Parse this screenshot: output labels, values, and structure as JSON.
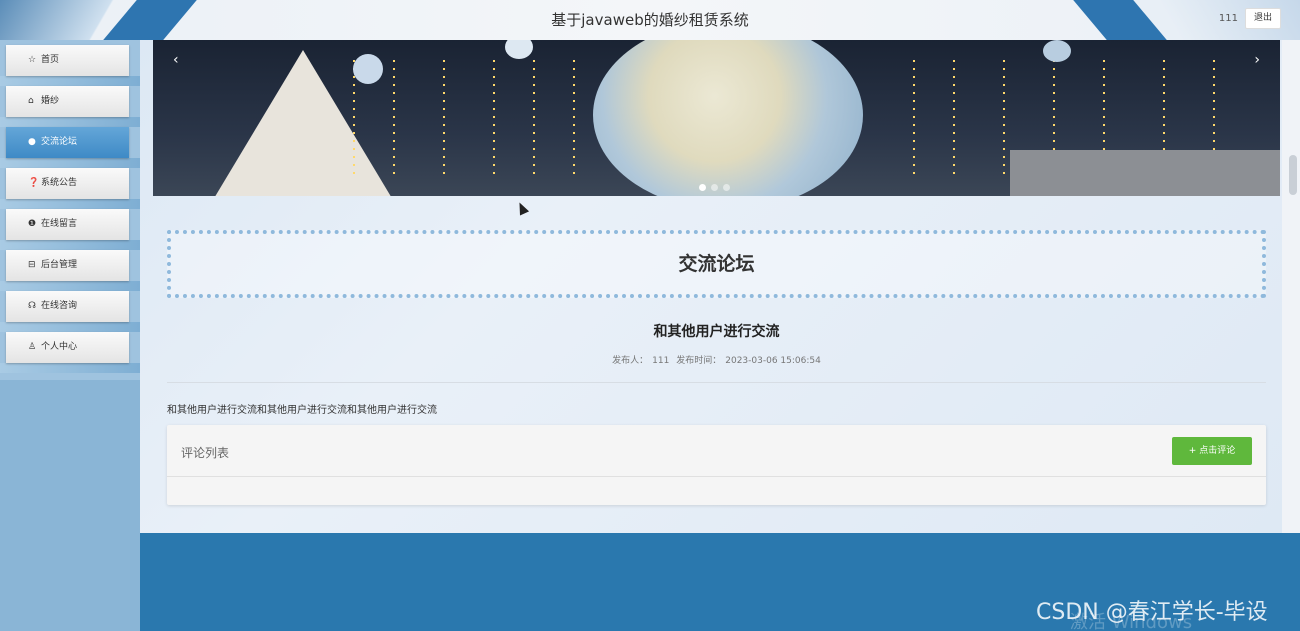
{
  "header": {
    "title": "基于javaweb的婚纱租赁系统",
    "user": "111",
    "logout_label": "退出"
  },
  "sidebar": {
    "items": [
      {
        "label": "首页",
        "icon": "star-icon",
        "glyph": "☆"
      },
      {
        "label": "婚纱",
        "icon": "lock-icon",
        "glyph": "⌂"
      },
      {
        "label": "交流论坛",
        "icon": "chat-icon",
        "glyph": "●"
      },
      {
        "label": "系统公告",
        "icon": "question-icon",
        "glyph": "❓"
      },
      {
        "label": "在线留言",
        "icon": "info-icon",
        "glyph": "❶"
      },
      {
        "label": "后台管理",
        "icon": "briefcase-icon",
        "glyph": "⊟"
      },
      {
        "label": "在线咨询",
        "icon": "headset-icon",
        "glyph": "☊"
      },
      {
        "label": "个人中心",
        "icon": "user-icon",
        "glyph": "♙"
      }
    ],
    "active_index": 2
  },
  "banner": {
    "prev": "‹",
    "next": "›",
    "slides": 3,
    "active_slide": 0
  },
  "forum": {
    "section_title": "交流论坛",
    "post_title": "和其他用户进行交流",
    "author_label": "发布人：",
    "author": "111",
    "time_label": "发布时间：",
    "time": "2023-03-06 15:06:54",
    "body": "和其他用户进行交流和其他用户进行交流和其他用户进行交流"
  },
  "comments": {
    "header": "评论列表",
    "add_label": "+ 点击评论"
  },
  "watermark": {
    "text": "CSDN @春江学长-毕设",
    "os_text": "激活 Windows"
  },
  "colors": {
    "accent": "#2a78ae",
    "active_nav": "#4a93cc",
    "add_button": "#5fb83c"
  }
}
